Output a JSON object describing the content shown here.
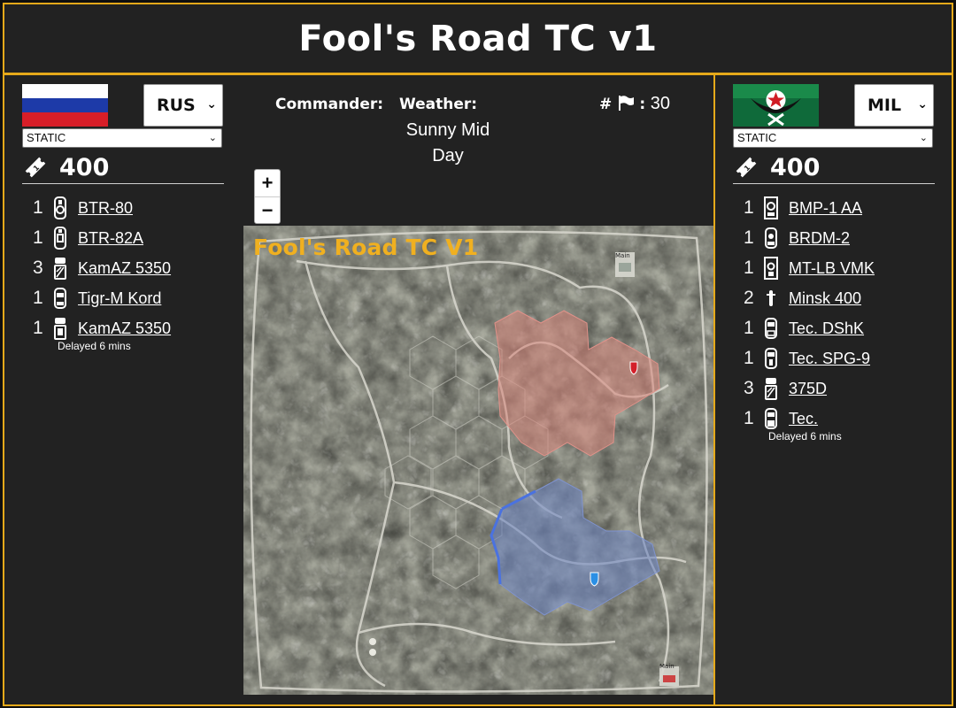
{
  "title": "Fool's Road TC v1",
  "colors": {
    "accent_border": "#e5a91a",
    "panel_bg": "#222222",
    "map_title": "#f0b020",
    "team1_zone": "#d9857a",
    "team2_zone": "#6f87c2"
  },
  "left": {
    "flag": "russia-flag",
    "faction": "RUS",
    "mode": "STATIC",
    "points": "400",
    "units": [
      {
        "count": "1",
        "name": "BTR-80",
        "icon": "apc-icon"
      },
      {
        "count": "1",
        "name": "BTR-82A",
        "icon": "apc-icon"
      },
      {
        "count": "3",
        "name": "KamAZ 5350",
        "icon": "truck-icon"
      },
      {
        "count": "1",
        "name": "Tigr-M Kord",
        "icon": "car-icon"
      },
      {
        "count": "1",
        "name": "KamAZ 5350",
        "icon": "truck-icon"
      }
    ],
    "delay_note": "Delayed 6 mins"
  },
  "right": {
    "flag": "militia-flag",
    "faction": "MIL",
    "mode": "STATIC",
    "points": "400",
    "units": [
      {
        "count": "1",
        "name": "BMP-1 AA",
        "icon": "ifv-icon"
      },
      {
        "count": "1",
        "name": "BRDM-2",
        "icon": "car-icon"
      },
      {
        "count": "1",
        "name": "MT-LB VMK",
        "icon": "apc-icon"
      },
      {
        "count": "2",
        "name": "Minsk 400",
        "icon": "motorbike-icon"
      },
      {
        "count": "1",
        "name": "Tec. DShK",
        "icon": "car-icon"
      },
      {
        "count": "1",
        "name": "Tec. SPG-9",
        "icon": "car-icon"
      },
      {
        "count": "3",
        "name": "375D",
        "icon": "truck-icon"
      },
      {
        "count": "1",
        "name": "Tec.",
        "icon": "car-icon"
      }
    ],
    "delay_note": "Delayed 6 mins"
  },
  "info": {
    "commander_label": "Commander:",
    "commander_value": "",
    "weather_label": "Weather:",
    "weather_value": "Sunny Mid Day",
    "flags_label": "#",
    "flags_value": "30"
  },
  "map": {
    "title": "Fool's Road TC V1",
    "zoom_in": "+",
    "zoom_out": "−",
    "main_label_top": "Main",
    "main_label_bottom": "Main"
  }
}
